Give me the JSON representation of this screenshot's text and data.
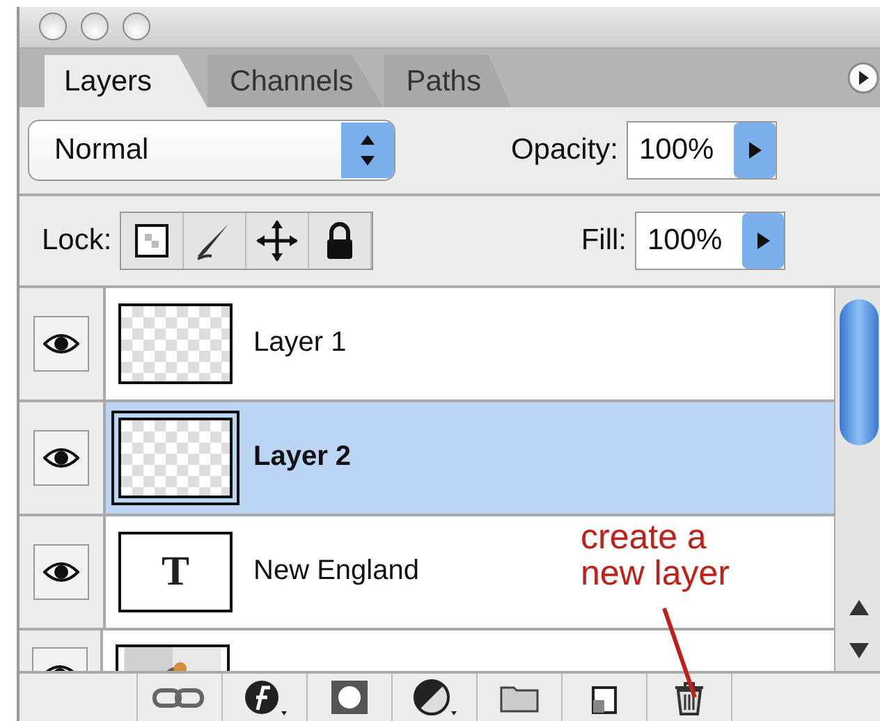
{
  "tabs": [
    {
      "label": "Layers",
      "selected": true
    },
    {
      "label": "Channels",
      "selected": false
    },
    {
      "label": "Paths",
      "selected": false
    }
  ],
  "blend_mode": {
    "value": "Normal"
  },
  "opacity": {
    "label": "Opacity:",
    "value": "100%"
  },
  "lock": {
    "label": "Lock:"
  },
  "fill": {
    "label": "Fill:",
    "value": "100%"
  },
  "layers": [
    {
      "name": "Layer 1",
      "kind": "transparent",
      "visible": true,
      "selected": false
    },
    {
      "name": "Layer 2",
      "kind": "transparent",
      "visible": true,
      "selected": true
    },
    {
      "name": "New England",
      "kind": "text",
      "thumb_text": "T",
      "visible": true,
      "selected": false
    },
    {
      "kind": "picture",
      "visible": true,
      "selected": false
    }
  ],
  "annotation": {
    "text": "create a\nnew layer"
  }
}
